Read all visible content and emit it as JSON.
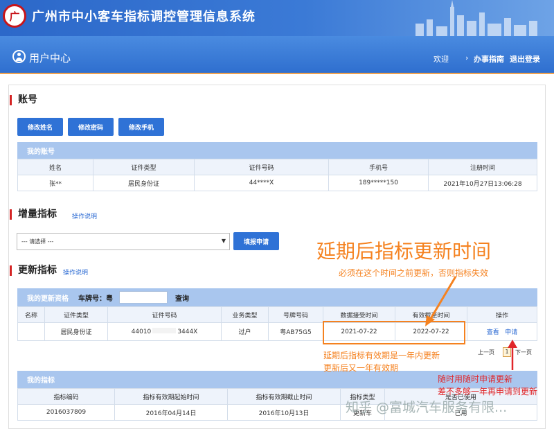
{
  "header": {
    "logo_glyph": "广",
    "system_title": "广州市中小客车指标调控管理信息系统"
  },
  "nav": {
    "user_center": "用户中心",
    "welcome": "欢迎",
    "guide": "办事指南",
    "logout": "退出登录"
  },
  "account": {
    "section_title": "账号",
    "buttons": [
      "修改姓名",
      "修改密码",
      "修改手机"
    ],
    "panel_title": "我的账号",
    "columns": [
      "姓名",
      "证件类型",
      "证件号码",
      "手机号",
      "注册时间"
    ],
    "row": [
      "张**",
      "居民身份证",
      "44****X",
      "189*****150",
      "2021年10月27日13:06:28"
    ]
  },
  "increment": {
    "section_title": "增量指标",
    "help_link": "操作说明",
    "select_value": "--- 请选择 ---",
    "apply_button": "填报申请"
  },
  "renewal": {
    "section_title": "更新指标",
    "help_link": "操作说明",
    "panel_title": "我的更新资格",
    "plate_label": "车牌号：粤",
    "query_link": "查询",
    "columns": [
      "名称",
      "证件类型",
      "证件号码",
      "业务类型",
      "号牌号码",
      "数据接受时间",
      "有效截至时间",
      "操作"
    ],
    "row": {
      "name": "",
      "id_type": "居民身份证",
      "id_number": "44010",
      "id_number_tail": "3444X",
      "business": "过户",
      "plate": "粤AB75G5",
      "received": "2021-07-22",
      "valid_until": "2022-07-22",
      "action_view": "查看",
      "action_apply": "申请"
    },
    "pager": {
      "prev": "上一页",
      "page": "1",
      "next": "下一页"
    }
  },
  "my_quota": {
    "panel_title": "我的指标",
    "columns": [
      "指标编码",
      "指标有效期起始时间",
      "指标有效期截止时间",
      "指标类型",
      "是否已使用"
    ],
    "row": [
      "2016037809",
      "2016年04月14日",
      "2016年10月13日",
      "更新车",
      "已用"
    ]
  },
  "annotations": {
    "big": "延期后指标更新时间",
    "note1": "必须在这个时间之前更新，否则指标失效",
    "note2_line1": "延期后指标有效期是一年内更新",
    "note2_line2": "更新后又一年有效期",
    "red_line1": "随时用随时申请更新",
    "red_line2": "差不多够一年再申请到更新",
    "watermark": "知乎 @富城汽车服务有限..."
  },
  "colors": {
    "header_blue": "#2c68c9",
    "accent_red": "#d42424",
    "annotation_orange": "#f58220",
    "annotation_red": "#e0262a"
  }
}
